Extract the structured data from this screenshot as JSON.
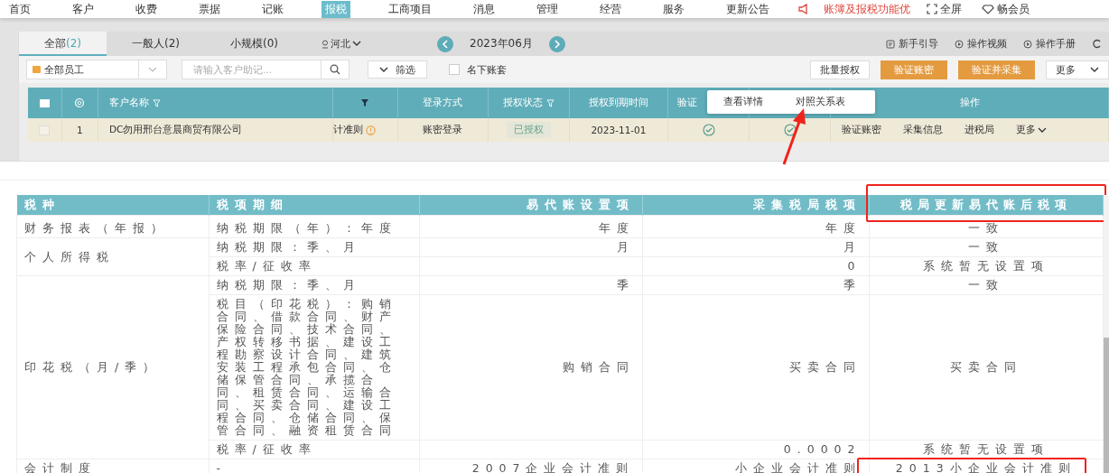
{
  "nav": {
    "items": [
      {
        "label": "首页",
        "selected": false
      },
      {
        "label": "客户",
        "selected": false
      },
      {
        "label": "收费",
        "selected": false
      },
      {
        "label": "票据",
        "selected": false
      },
      {
        "label": "记账",
        "selected": false
      },
      {
        "label": "报税",
        "selected": true
      },
      {
        "label": "工商项目",
        "selected": false
      },
      {
        "label": "消息",
        "selected": false
      },
      {
        "label": "管理",
        "selected": false
      },
      {
        "label": "经营",
        "selected": false
      },
      {
        "label": "服务",
        "selected": false
      },
      {
        "label": "更新公告",
        "selected": false
      }
    ],
    "notice": "账簿及报税功能优",
    "fullscreen": "全屏",
    "vip": "畅会员"
  },
  "panel": {
    "tabs": [
      {
        "label": "全部",
        "count": "(2)",
        "selected": true
      },
      {
        "label": "一般人",
        "count": "(2)",
        "selected": false
      },
      {
        "label": "小规模",
        "count": "(0)",
        "selected": false
      }
    ],
    "region": "河北",
    "month": "2023年06月",
    "help_links": [
      "新手引导",
      "操作视频",
      "操作手册"
    ],
    "staff_select": "全部员工",
    "search": {
      "placeholder": "请输入客户助记..."
    },
    "filter_button": "筛选",
    "own_accounts": {
      "label": "名下账套",
      "checked": false
    },
    "actions": [
      {
        "label": "批量授权",
        "kind": "plain"
      },
      {
        "label": "验证账密",
        "kind": "primary"
      },
      {
        "label": "验证并采集",
        "kind": "primary"
      },
      {
        "label": "更多",
        "kind": "dropdown"
      }
    ]
  },
  "table": {
    "all_checked": false,
    "columns": [
      {
        "kind": "checkbox"
      },
      {
        "kind": "settings"
      },
      {
        "label": "客户名称",
        "filter": true
      },
      {
        "kind": "filter_only"
      },
      {
        "label": "登录方式",
        "filter": false
      },
      {
        "label": "授权状态",
        "filter": true
      },
      {
        "label": "授权到期时间",
        "filter": false
      },
      {
        "label": "验证",
        "filter": false
      },
      {
        "kind": "blank"
      },
      {
        "label": "操作",
        "filter": false
      }
    ],
    "rows": [
      {
        "checked": false,
        "index": "1",
        "name": "DC勿用邢台意晨商贸有限公司",
        "standard": "计准则",
        "warning": true,
        "login": "账密登录",
        "auth_status": "已授权",
        "expiry": "2023-11-01",
        "verified_1": true,
        "verified_2": true,
        "operations": [
          "验证账密",
          "采集信息",
          "进税局",
          "更多"
        ]
      }
    ]
  },
  "popup": {
    "items": [
      "查看详情",
      "对照关系表"
    ]
  },
  "comparison": {
    "columns": [
      {
        "label": "税种",
        "highlighted": false
      },
      {
        "label": "税项期细",
        "highlighted": false
      },
      {
        "label": "易代账设置项",
        "highlighted": false
      },
      {
        "label": "采集税局税项",
        "highlighted": false
      },
      {
        "label": "税局更新易代账后税项",
        "highlighted": true
      }
    ],
    "groups": [
      {
        "tax_type": "财务报表（年报）",
        "items": [
          {
            "detail": "纳税期限（年）：年度",
            "system": "年度",
            "collected": "年度",
            "updated": "一致",
            "highlighted": false
          }
        ]
      },
      {
        "tax_type": "个人所得税",
        "items": [
          {
            "detail": "纳税期限：季、月",
            "system": "月",
            "collected": "月",
            "updated": "一致",
            "highlighted": false
          },
          {
            "detail": "税率/征收率",
            "collected": "0",
            "updated": "系统暂无设置项",
            "highlighted": false
          }
        ]
      },
      {
        "tax_type": "印花税（月/季）",
        "items": [
          {
            "detail": "纳税期限：季、月",
            "system": "季",
            "collected": "季",
            "updated": "一致",
            "highlighted": false
          },
          {
            "detail": "税目（印花税）：购销合同、借款合同、财产保险合同、技术合同、产权转移书据、建设工程勘察设计合同、建筑安装工程承包合同、仓储保管合同、承揽合同、租赁合同、运输合同、买卖合同、建设工程合同、仓储合同、保管合同、融资租赁合同",
            "system": "购销合同",
            "collected": "买卖合同",
            "updated": "买卖合同",
            "highlighted": false
          },
          {
            "detail": "税率/征收率",
            "collected": "0.0002",
            "updated": "系统暂无设置项",
            "highlighted": false
          }
        ]
      },
      {
        "tax_type": "会计制度",
        "items": [
          {
            "detail": "-",
            "system": "2007企业会计准则",
            "collected": "小企业会计准则",
            "updated": "2013小企业会计准则",
            "highlighted": true
          }
        ]
      }
    ]
  }
}
